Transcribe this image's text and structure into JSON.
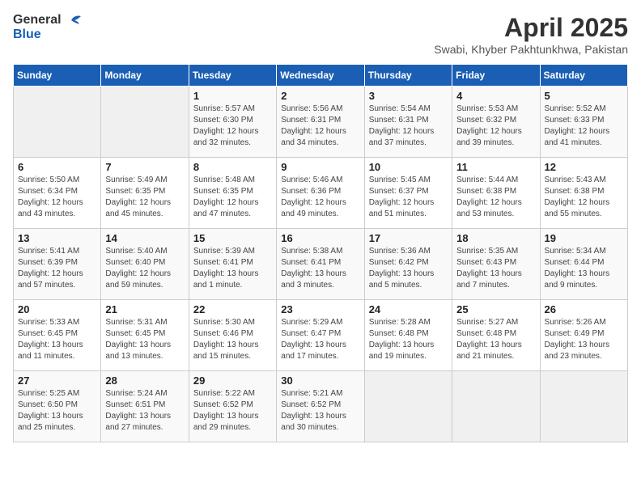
{
  "header": {
    "logo_general": "General",
    "logo_blue": "Blue",
    "month_title": "April 2025",
    "location": "Swabi, Khyber Pakhtunkhwa, Pakistan"
  },
  "days_of_week": [
    "Sunday",
    "Monday",
    "Tuesday",
    "Wednesday",
    "Thursday",
    "Friday",
    "Saturday"
  ],
  "weeks": [
    [
      {
        "day": "",
        "info": ""
      },
      {
        "day": "",
        "info": ""
      },
      {
        "day": "1",
        "sunrise": "5:57 AM",
        "sunset": "6:30 PM",
        "daylight": "12 hours and 32 minutes."
      },
      {
        "day": "2",
        "sunrise": "5:56 AM",
        "sunset": "6:31 PM",
        "daylight": "12 hours and 34 minutes."
      },
      {
        "day": "3",
        "sunrise": "5:54 AM",
        "sunset": "6:31 PM",
        "daylight": "12 hours and 37 minutes."
      },
      {
        "day": "4",
        "sunrise": "5:53 AM",
        "sunset": "6:32 PM",
        "daylight": "12 hours and 39 minutes."
      },
      {
        "day": "5",
        "sunrise": "5:52 AM",
        "sunset": "6:33 PM",
        "daylight": "12 hours and 41 minutes."
      }
    ],
    [
      {
        "day": "6",
        "sunrise": "5:50 AM",
        "sunset": "6:34 PM",
        "daylight": "12 hours and 43 minutes."
      },
      {
        "day": "7",
        "sunrise": "5:49 AM",
        "sunset": "6:35 PM",
        "daylight": "12 hours and 45 minutes."
      },
      {
        "day": "8",
        "sunrise": "5:48 AM",
        "sunset": "6:35 PM",
        "daylight": "12 hours and 47 minutes."
      },
      {
        "day": "9",
        "sunrise": "5:46 AM",
        "sunset": "6:36 PM",
        "daylight": "12 hours and 49 minutes."
      },
      {
        "day": "10",
        "sunrise": "5:45 AM",
        "sunset": "6:37 PM",
        "daylight": "12 hours and 51 minutes."
      },
      {
        "day": "11",
        "sunrise": "5:44 AM",
        "sunset": "6:38 PM",
        "daylight": "12 hours and 53 minutes."
      },
      {
        "day": "12",
        "sunrise": "5:43 AM",
        "sunset": "6:38 PM",
        "daylight": "12 hours and 55 minutes."
      }
    ],
    [
      {
        "day": "13",
        "sunrise": "5:41 AM",
        "sunset": "6:39 PM",
        "daylight": "12 hours and 57 minutes."
      },
      {
        "day": "14",
        "sunrise": "5:40 AM",
        "sunset": "6:40 PM",
        "daylight": "12 hours and 59 minutes."
      },
      {
        "day": "15",
        "sunrise": "5:39 AM",
        "sunset": "6:41 PM",
        "daylight": "13 hours and 1 minute."
      },
      {
        "day": "16",
        "sunrise": "5:38 AM",
        "sunset": "6:41 PM",
        "daylight": "13 hours and 3 minutes."
      },
      {
        "day": "17",
        "sunrise": "5:36 AM",
        "sunset": "6:42 PM",
        "daylight": "13 hours and 5 minutes."
      },
      {
        "day": "18",
        "sunrise": "5:35 AM",
        "sunset": "6:43 PM",
        "daylight": "13 hours and 7 minutes."
      },
      {
        "day": "19",
        "sunrise": "5:34 AM",
        "sunset": "6:44 PM",
        "daylight": "13 hours and 9 minutes."
      }
    ],
    [
      {
        "day": "20",
        "sunrise": "5:33 AM",
        "sunset": "6:45 PM",
        "daylight": "13 hours and 11 minutes."
      },
      {
        "day": "21",
        "sunrise": "5:31 AM",
        "sunset": "6:45 PM",
        "daylight": "13 hours and 13 minutes."
      },
      {
        "day": "22",
        "sunrise": "5:30 AM",
        "sunset": "6:46 PM",
        "daylight": "13 hours and 15 minutes."
      },
      {
        "day": "23",
        "sunrise": "5:29 AM",
        "sunset": "6:47 PM",
        "daylight": "13 hours and 17 minutes."
      },
      {
        "day": "24",
        "sunrise": "5:28 AM",
        "sunset": "6:48 PM",
        "daylight": "13 hours and 19 minutes."
      },
      {
        "day": "25",
        "sunrise": "5:27 AM",
        "sunset": "6:48 PM",
        "daylight": "13 hours and 21 minutes."
      },
      {
        "day": "26",
        "sunrise": "5:26 AM",
        "sunset": "6:49 PM",
        "daylight": "13 hours and 23 minutes."
      }
    ],
    [
      {
        "day": "27",
        "sunrise": "5:25 AM",
        "sunset": "6:50 PM",
        "daylight": "13 hours and 25 minutes."
      },
      {
        "day": "28",
        "sunrise": "5:24 AM",
        "sunset": "6:51 PM",
        "daylight": "13 hours and 27 minutes."
      },
      {
        "day": "29",
        "sunrise": "5:22 AM",
        "sunset": "6:52 PM",
        "daylight": "13 hours and 29 minutes."
      },
      {
        "day": "30",
        "sunrise": "5:21 AM",
        "sunset": "6:52 PM",
        "daylight": "13 hours and 30 minutes."
      },
      {
        "day": "",
        "info": ""
      },
      {
        "day": "",
        "info": ""
      },
      {
        "day": "",
        "info": ""
      }
    ]
  ]
}
